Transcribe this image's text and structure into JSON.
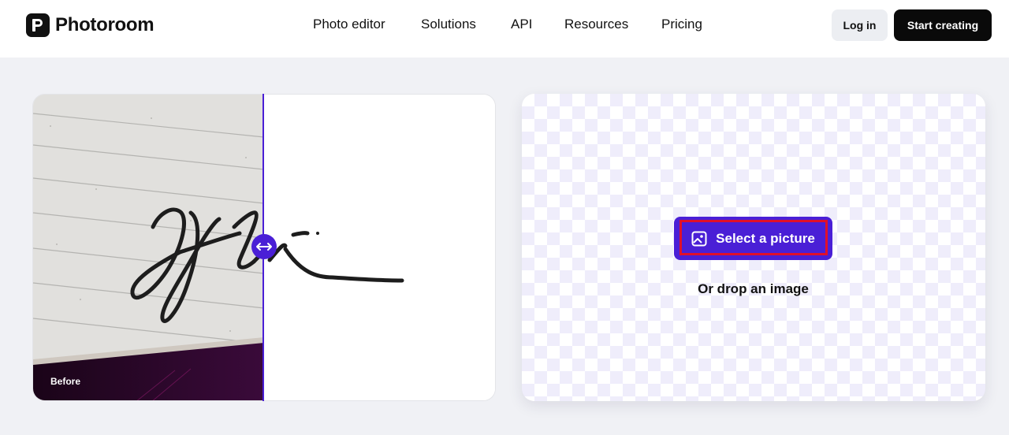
{
  "brand": {
    "name": "Photoroom"
  },
  "nav": {
    "items": [
      {
        "label": "Photo editor"
      },
      {
        "label": "Solutions"
      },
      {
        "label": "API"
      },
      {
        "label": "Resources"
      },
      {
        "label": "Pricing"
      }
    ]
  },
  "header_actions": {
    "login_label": "Log in",
    "start_label": "Start creating"
  },
  "preview": {
    "before_label": "Before"
  },
  "upload": {
    "select_label": "Select a picture",
    "drop_label": "Or drop an image"
  },
  "colors": {
    "accent": "#4a1fd6",
    "highlight": "#e0102a",
    "dark": "#0a0a0a"
  },
  "icons": {
    "logo": "photoroom-logo-icon",
    "compare": "left-right-arrow-icon",
    "image": "image-icon"
  }
}
